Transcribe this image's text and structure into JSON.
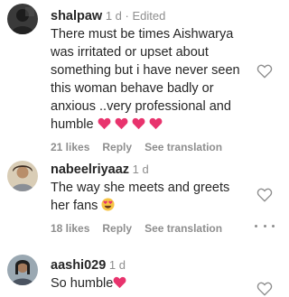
{
  "comments": [
    {
      "username": "shalpaw",
      "meta": " 1 d · Edited",
      "text": "There must be times Aishwarya was irritated or upset about something but i have never seen this woman behave badly or anxious ..very professional and humble",
      "emojis": [
        "heart",
        "heart",
        "heart",
        "heart"
      ],
      "likes": "21 likes",
      "reply": "Reply",
      "see_translation": "See translation",
      "avatar_color": "#2f2f2f"
    },
    {
      "username": "nabeelriyaaz",
      "meta": " 1 d",
      "text": "The way she meets and greets her fans",
      "emojis": [
        "heart-eyes"
      ],
      "likes": "18 likes",
      "reply": "Reply",
      "see_translation": "See translation",
      "avatar_color": "#c8b89a"
    },
    {
      "username": "aashi029",
      "meta": " 1 d",
      "text": "So humble",
      "emojis": [
        "heart"
      ],
      "avatar_color": "#6b7c8c"
    }
  ],
  "colors": {
    "text": "#262626",
    "muted": "#8e8e8e",
    "heart_emoji": "#e8336d"
  },
  "icons": {
    "like": "heart-outline-icon",
    "more": "more-options-icon"
  }
}
